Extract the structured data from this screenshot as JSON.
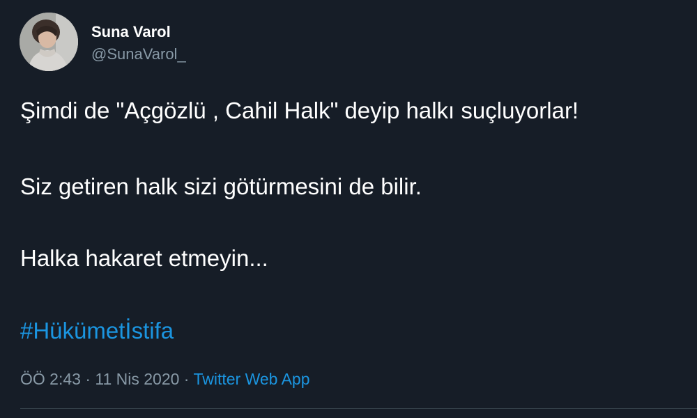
{
  "tweet": {
    "author": {
      "display_name": "Suna Varol",
      "handle": "@SunaVarol_"
    },
    "paragraphs": [
      "Şimdi de \"Açgözlü , Cahil Halk\" deyip halkı suçluyorlar!",
      "Siz getiren halk sizi götürmesini de bilir.",
      "Halka hakaret etmeyin..."
    ],
    "hashtag": "#Hükümetİstifa",
    "timestamp": "ÖÖ 2:43 · 11 Nis 2020 · ",
    "source": "Twitter Web App"
  },
  "colors": {
    "background": "#161d27",
    "text": "#ffffff",
    "secondary_text": "#8899a6",
    "link": "#1b95e0",
    "divider": "#38444d"
  }
}
